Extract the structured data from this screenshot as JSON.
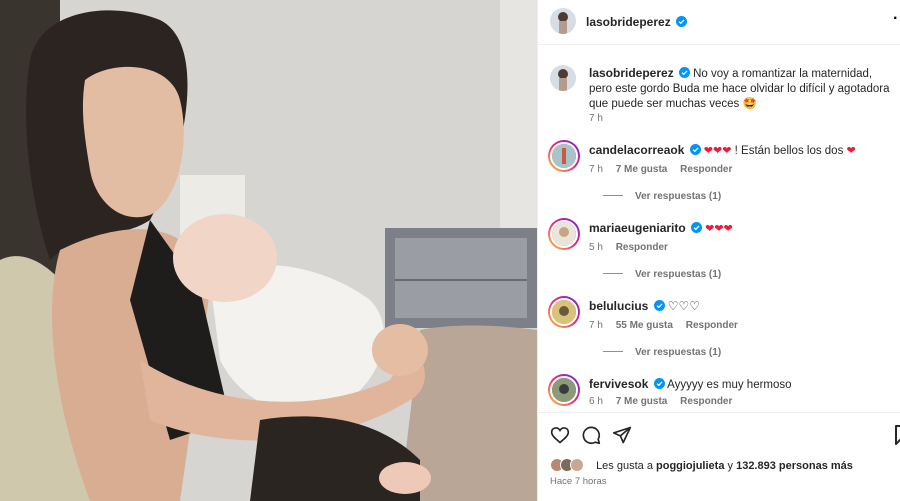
{
  "post": {
    "author": "lasobrideperez",
    "caption": "No voy a romantizar la maternidad, pero este gordo Buda me hace olvidar lo difícil y agotadora que puede ser muchas veces",
    "caption_emoji": "🤩",
    "caption_time": "7 h",
    "more_label": "·"
  },
  "comments": [
    {
      "user": "candelacorreaok",
      "text_suffix": "! Están bellos los dos",
      "time": "7 h",
      "likes": "7 Me gusta",
      "reply": "Responder",
      "replies": "Ver respuestas (1)"
    },
    {
      "user": "mariaeugeniarito",
      "time": "5 h",
      "reply": "Responder",
      "replies": "Ver respuestas (1)"
    },
    {
      "user": "belulucius",
      "time": "7 h",
      "likes": "55 Me gusta",
      "reply": "Responder",
      "replies": "Ver respuestas (1)"
    },
    {
      "user": "fervivesok",
      "text": "Ayyyyy es muy hermoso",
      "time": "6 h",
      "likes": "7 Me gusta",
      "reply": "Responder"
    }
  ],
  "likes": {
    "prefix": "Les gusta a",
    "user": "poggiojulieta",
    "middle": "y",
    "count": "132.893 personas más"
  },
  "post_time": "Hace 7 horas",
  "icons": [
    "heart-icon",
    "comment-icon",
    "share-icon",
    "bookmark-icon",
    "verified-icon"
  ],
  "colors": {
    "verified": "#0095f6",
    "heart": "#ed1b3a",
    "meta": "#737373"
  }
}
